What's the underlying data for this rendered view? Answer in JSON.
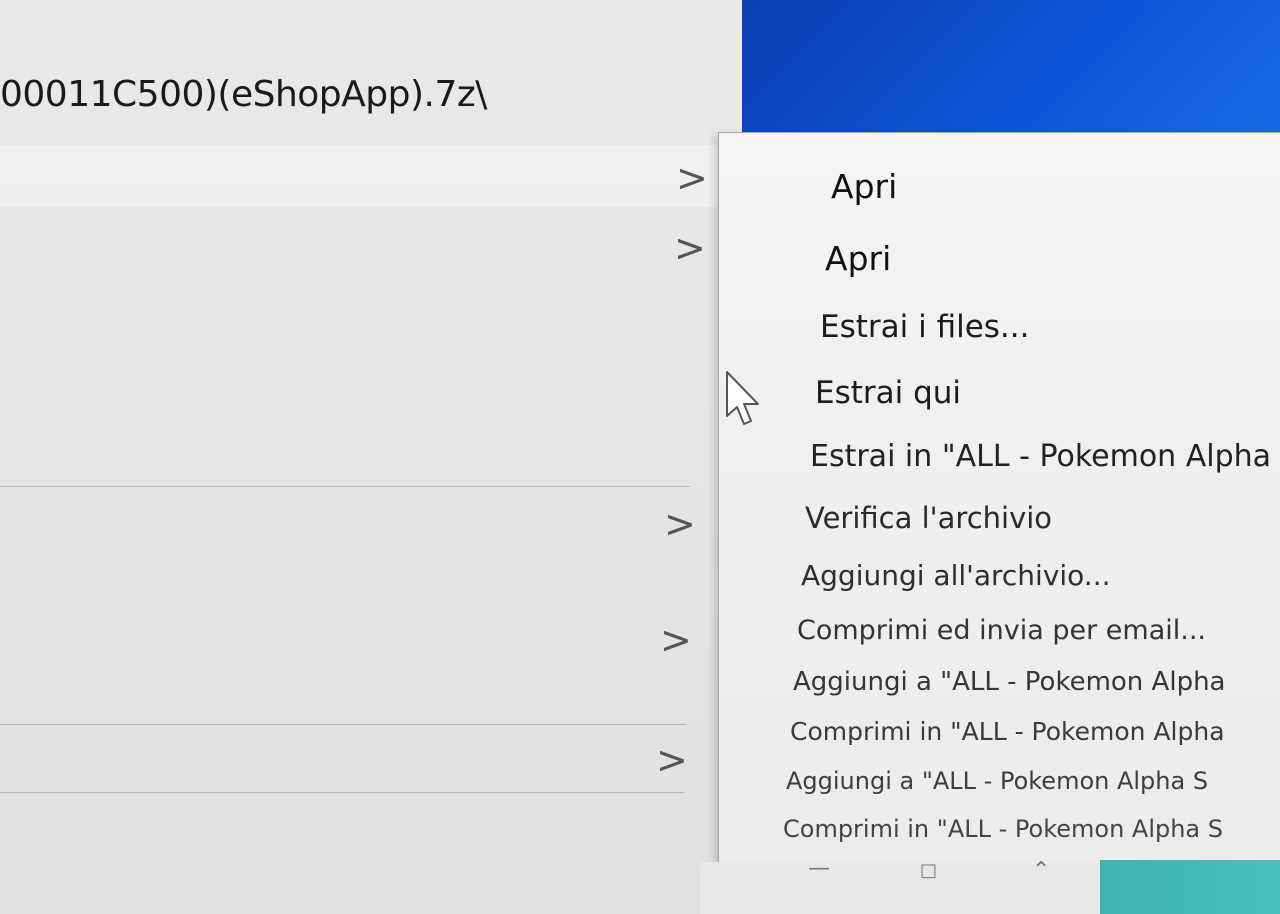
{
  "explorer": {
    "path_text": "00011C500)(eShopApp).7z\\"
  },
  "submenu": {
    "items": [
      {
        "label": "Apri"
      },
      {
        "label": "Apri"
      },
      {
        "label": "Estrai i files..."
      },
      {
        "label": "Estrai qui"
      },
      {
        "label": "Estrai in \"ALL - Pokemon Alpha"
      },
      {
        "label": "Verifica l'archivio"
      },
      {
        "label": "Aggiungi all'archivio..."
      },
      {
        "label": "Comprimi ed invia per email..."
      },
      {
        "label": "Aggiungi a \"ALL - Pokemon Alpha"
      },
      {
        "label": "Comprimi in \"ALL - Pokemon Alpha"
      },
      {
        "label": "Aggiungi a \"ALL - Pokemon Alpha S"
      },
      {
        "label": "Comprimi in \"ALL - Pokemon Alpha S"
      }
    ]
  },
  "icons": {
    "chevron": "chevron-right-icon",
    "cursor": "mouse-pointer-icon",
    "minimize": "minimize-icon",
    "maximize": "maximize-icon",
    "up": "chevron-up-icon"
  },
  "colors": {
    "desktop_blue": "#0d55d8",
    "menu_bg": "#f0f0f0",
    "taskbar_teal": "#48c1bd"
  }
}
